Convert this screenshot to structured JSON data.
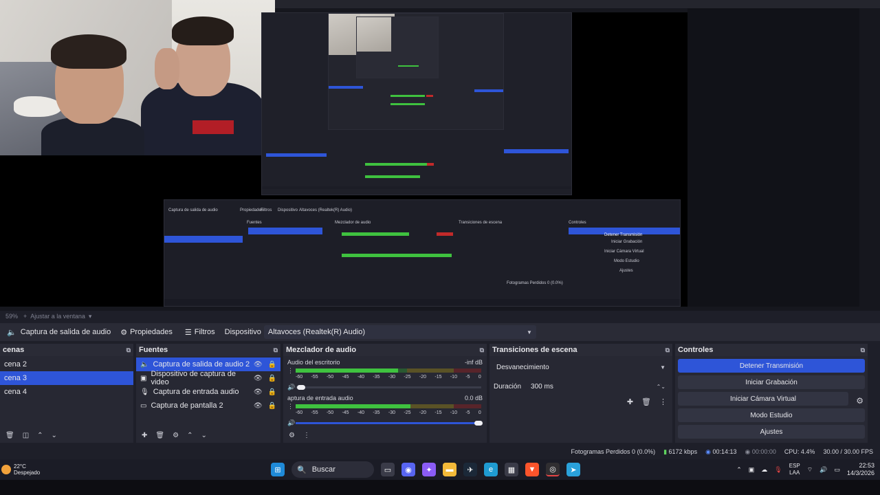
{
  "preview": {
    "zoom": "59%",
    "fit_label": "Ajustar a la ventana"
  },
  "toolbar": {
    "source_label": "Captura de salida de audio",
    "properties_label": "Propiedades",
    "filters_label": "Filtros",
    "device_label": "Dispositivo",
    "device_value": "Altavoces (Realtek(R) Audio)"
  },
  "scenes": {
    "title": "Escenas",
    "title_visible": "cenas",
    "items": [
      "cena 2",
      "cena 3",
      "cena 4"
    ],
    "selected_index": 1
  },
  "sources": {
    "title": "Fuentes",
    "items": [
      {
        "label": "Captura de salida de audio 2",
        "icon": "speaker-icon"
      },
      {
        "label": "Dispositivo de captura de video",
        "icon": "camera-icon"
      },
      {
        "label": "Captura de entrada audio",
        "icon": "microphone-icon"
      },
      {
        "label": "Captura de pantalla 2",
        "icon": "monitor-icon"
      }
    ],
    "selected_index": 0
  },
  "mixer": {
    "title": "Mezclador de audio",
    "channels": [
      {
        "name": "Audio del escritorio",
        "level": "-inf dB",
        "meter_fill": 0.55
      },
      {
        "name": "Captura de entrada audio",
        "name_visible": "aptura de entrada audio",
        "level": "0.0 dB",
        "meter_fill": 0.62
      }
    ],
    "scale": [
      "-60",
      "-55",
      "-50",
      "-45",
      "-40",
      "-35",
      "-30",
      "-25",
      "-20",
      "-15",
      "-10",
      "-5",
      "0"
    ]
  },
  "transitions": {
    "title": "Transiciones de escena",
    "selected": "Desvanecimiento",
    "duration_label": "Duración",
    "duration_value": "300 ms"
  },
  "controls": {
    "title": "Controles",
    "buttons": [
      "Detener Transmisión",
      "Iniciar Grabación",
      "Iniciar Cámara Virtual",
      "Modo Estudio",
      "Ajustes"
    ]
  },
  "status": {
    "dropped": "Fotogramas Perdidos 0 (0.0%)",
    "bitrate": "6172 kbps",
    "stream_time": "00:14:13",
    "rec_time": "00:00:00",
    "cpu": "CPU: 4.4%",
    "fps": "30.00 / 30.00 FPS"
  },
  "taskbar": {
    "temp": "22°C",
    "weather": "Despejado",
    "search": "Buscar",
    "lang_top": "ESP",
    "lang_bottom": "LAA",
    "time": "22:53",
    "date": "14/3/2026"
  },
  "colors": {
    "accent": "#2e55d8",
    "meter_green": "#3fc23f",
    "meter_yellow": "#c8b020",
    "meter_red": "#c22a2a"
  }
}
